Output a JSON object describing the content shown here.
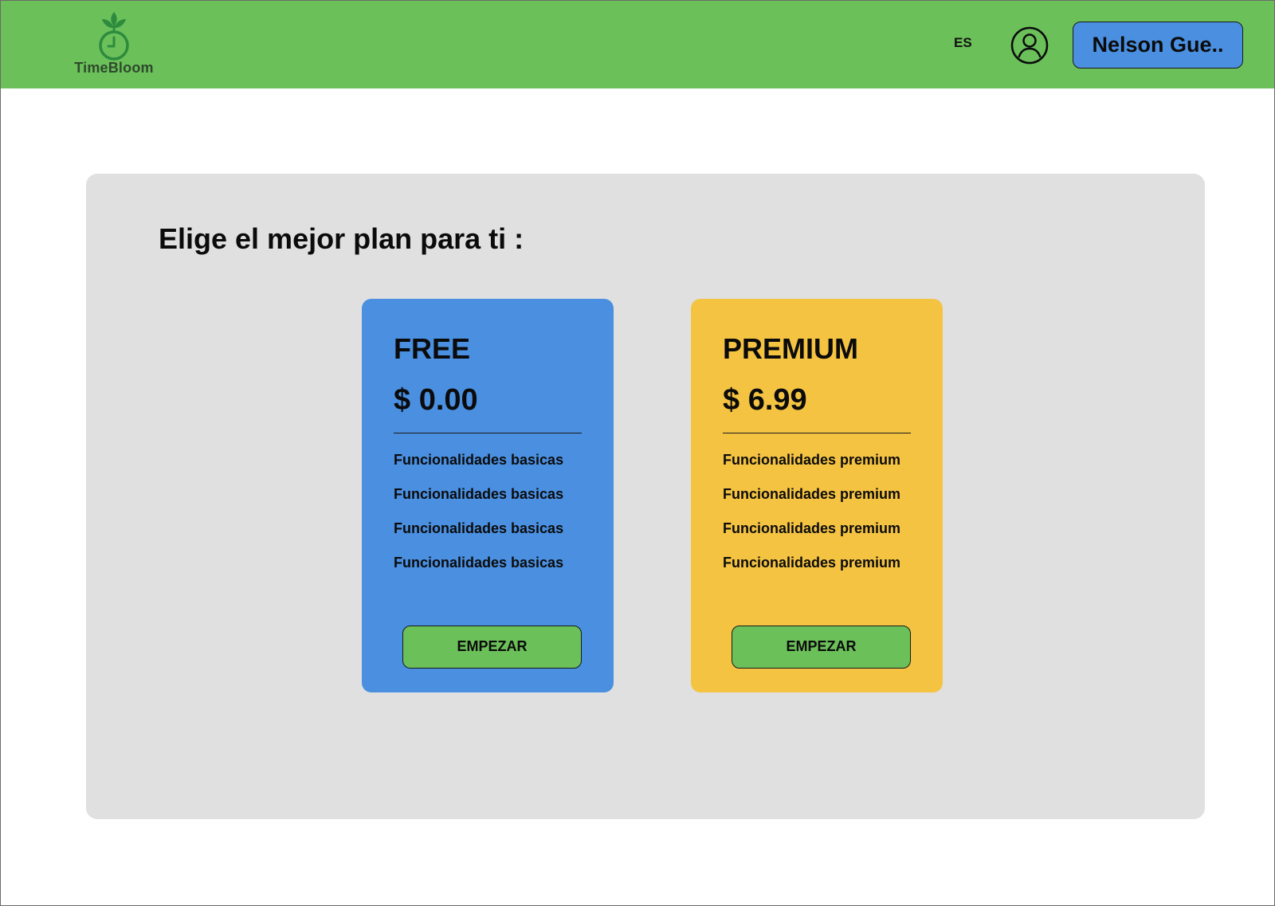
{
  "colors": {
    "header_bg": "#6bc05a",
    "accent_blue": "#4a8fe0",
    "accent_yellow": "#f4c342",
    "button_green": "#6bc05a",
    "panel_bg": "#e0e0e0",
    "logo_green": "#2e8b3e"
  },
  "header": {
    "logo_icon": "sprout-clock-icon",
    "logo_text": "TimeBloom",
    "language": "ES",
    "user_icon": "user-circle-icon",
    "user_button_label": "Nelson Gue.."
  },
  "pricing": {
    "title": "Elige el mejor plan para ti :",
    "plans": [
      {
        "name": "FREE",
        "price": "$ 0.00",
        "features": [
          "Funcionalidades basicas",
          "Funcionalidades basicas",
          "Funcionalidades basicas",
          "Funcionalidades basicas"
        ],
        "button_label": "EMPEZAR"
      },
      {
        "name": "PREMIUM",
        "price": "$ 6.99",
        "features": [
          "Funcionalidades premium",
          "Funcionalidades premium",
          "Funcionalidades premium",
          "Funcionalidades premium"
        ],
        "button_label": "EMPEZAR"
      }
    ]
  }
}
